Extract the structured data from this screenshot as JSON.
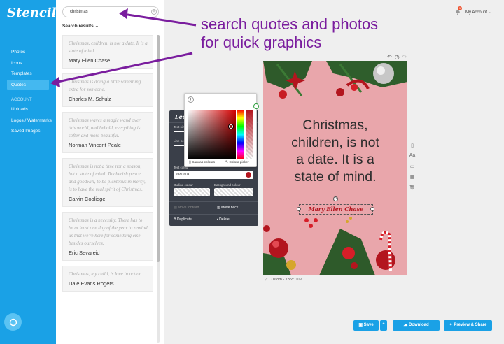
{
  "app": {
    "logo": "Stencil"
  },
  "sidebar": {
    "items": [
      {
        "label": "Photos"
      },
      {
        "label": "Icons"
      },
      {
        "label": "Templates"
      },
      {
        "label": "Quotes"
      }
    ],
    "account_section": "ACCOUNT",
    "account_items": [
      {
        "label": "Uploads"
      },
      {
        "label": "Logos / Watermarks"
      },
      {
        "label": "Saved Images"
      }
    ]
  },
  "search": {
    "value": "christmas",
    "results_label": "Search results ⌄"
  },
  "quotes": [
    {
      "text": "Christmas, children, is not a date. It is a state of mind.",
      "author": "Mary Ellen Chase"
    },
    {
      "text": "Christmas is doing a little something extra for someone.",
      "author": "Charles M. Schulz"
    },
    {
      "text": "Christmas waves a magic wand over this world, and behold, everything is softer and more beautiful.",
      "author": "Norman Vincent Peale"
    },
    {
      "text": "Christmas is not a time nor a season, but a state of mind. To cherish peace and goodwill, to be plenteous in mercy, is to have the real spirit of Christmas.",
      "author": "Calvin Coolidge"
    },
    {
      "text": "Christmas is a necessity. There has to be at least one day of the year to remind us that we're here for something else besides ourselves.",
      "author": "Eric Sevareid"
    },
    {
      "text": "Christmas, my child, is love in action.",
      "author": "Dale Evans Rogers"
    }
  ],
  "account": {
    "label": "My Account ⌄",
    "badge": "1"
  },
  "annotation": {
    "line1": "search quotes and photos",
    "line2": "for quick graphics"
  },
  "canvas": {
    "quote": "Christmas,\nchildren, is not\na date. It is a\nstate of mind.",
    "author": "Mary Ellen Chase",
    "size_label": "Custom - 735x1102",
    "colors": {
      "background": "#e9a6ab",
      "author": "#b3151e"
    }
  },
  "edit_panel": {
    "title": "Lech",
    "text_size": "Text size",
    "line_height": "Line height",
    "text_colour": "Text colour",
    "text_colour_value": "#a80a0a",
    "outline_colour": "Outline colour",
    "background_colour": "Background colour",
    "move_forward": "Move forward",
    "move_back": "Move back",
    "duplicate": "Duplicate",
    "delete": "Delete"
  },
  "picker": {
    "canvas_colours": "Canvas colours",
    "colour_picker": "Colour picker"
  },
  "buttons": {
    "save": "Save",
    "download": "Download",
    "preview": "Preview & Share"
  },
  "accent": "#1aa1e6"
}
